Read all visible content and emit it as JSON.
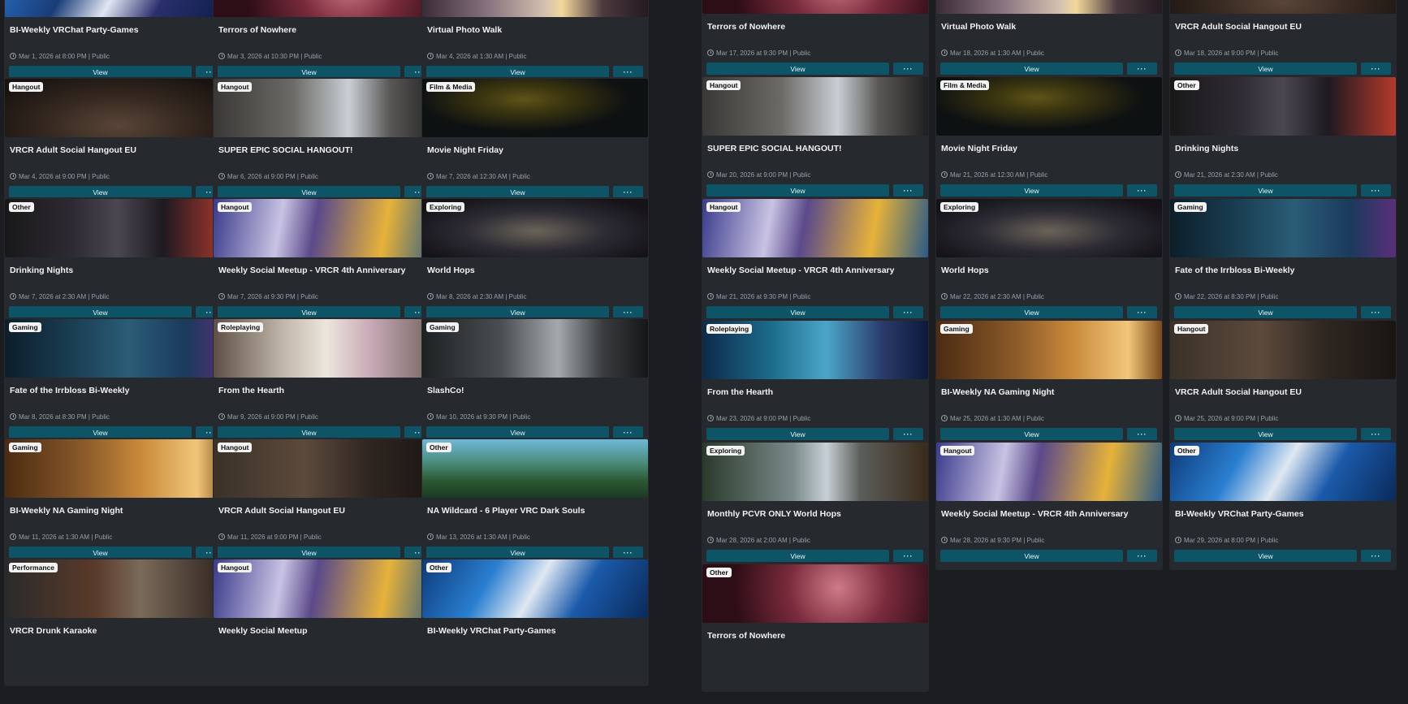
{
  "common": {
    "view_label": "View",
    "more_label": "···"
  },
  "left_cards": [
    {
      "tag": "",
      "title": "BI-Weekly VRChat Party-Games",
      "meta": "Mar 1, 2026 at 8:00 PM  |  Public",
      "thumb": "t1"
    },
    {
      "tag": "",
      "title": "Terrors of Nowhere",
      "meta": "Mar 3, 2026 at 10:30 PM  |  Public",
      "thumb": "t2"
    },
    {
      "tag": "",
      "title": "Virtual Photo Walk",
      "meta": "Mar 4, 2026 at 1:30 AM  |  Public",
      "thumb": "t3"
    },
    {
      "tag": "Hangout",
      "title": "VRCR Adult Social Hangout EU",
      "meta": "Mar 4, 2026 at 9:00 PM  |  Public",
      "thumb": "t4"
    },
    {
      "tag": "Hangout",
      "title": "SUPER EPIC SOCIAL HANGOUT!",
      "meta": "Mar 6, 2026 at 9:00 PM  |  Public",
      "thumb": "t5"
    },
    {
      "tag": "Film & Media",
      "title": "Movie Night Friday",
      "meta": "Mar 7, 2026 at 12:30 AM  |  Public",
      "thumb": "t6"
    },
    {
      "tag": "Other",
      "title": "Drinking Nights",
      "meta": "Mar 7, 2026 at 2:30 AM  |  Public",
      "thumb": "t7"
    },
    {
      "tag": "Hangout",
      "title": "Weekly Social Meetup - VRCR 4th Anniversary",
      "meta": "Mar 7, 2026 at 9:30 PM  |  Public",
      "thumb": "t8"
    },
    {
      "tag": "Exploring",
      "title": "World Hops",
      "meta": "Mar 8, 2026 at 2:30 AM  |  Public",
      "thumb": "t9"
    },
    {
      "tag": "Gaming",
      "title": "Fate of the Irrbloss Bi-Weekly",
      "meta": "Mar 8, 2026 at 8:30 PM  |  Public",
      "thumb": "t10"
    },
    {
      "tag": "Roleplaying",
      "title": "From the Hearth",
      "meta": "Mar 9, 2026 at 9:00 PM  |  Public",
      "thumb": "t11"
    },
    {
      "tag": "Gaming",
      "title": "SlashCo!",
      "meta": "Mar 10, 2026 at 9:30 PM  |  Public",
      "thumb": "t12"
    },
    {
      "tag": "Gaming",
      "title": "BI-Weekly NA Gaming Night",
      "meta": "Mar 11, 2026 at 1:30 AM  |  Public",
      "thumb": "t13"
    },
    {
      "tag": "Hangout",
      "title": "VRCR Adult Social Hangout EU",
      "meta": "Mar 11, 2026 at 9:00 PM  |  Public",
      "thumb": "t14"
    },
    {
      "tag": "Other",
      "title": "NA Wildcard - 6 Player VRC Dark Souls",
      "meta": "Mar 13, 2026 at 1:30 AM  |  Public",
      "thumb": "t15"
    },
    {
      "tag": "Performance",
      "title": "VRCR Drunk Karaoke",
      "meta": "",
      "thumb": "t16"
    },
    {
      "tag": "Hangout",
      "title": "Weekly Social Meetup",
      "meta": "",
      "thumb": "t8"
    },
    {
      "tag": "Other",
      "title": "BI-Weekly VRChat Party-Games",
      "meta": "",
      "thumb": "t17"
    }
  ],
  "right_cards": [
    {
      "tag": "",
      "title": "Terrors of Nowhere",
      "meta": "Mar 17, 2026 at 9:30 PM  |  Public",
      "thumb": "t2"
    },
    {
      "tag": "",
      "title": "Virtual Photo Walk",
      "meta": "Mar 18, 2026 at 1:30 AM  |  Public",
      "thumb": "t3"
    },
    {
      "tag": "",
      "title": "VRCR Adult Social Hangout EU",
      "meta": "Mar 18, 2026 at 9:00 PM  |  Public",
      "thumb": "t4"
    },
    {
      "tag": "Hangout",
      "title": "SUPER EPIC SOCIAL HANGOUT!",
      "meta": "Mar 20, 2026 at 9:00 PM  |  Public",
      "thumb": "t5"
    },
    {
      "tag": "Film & Media",
      "title": "Movie Night Friday",
      "meta": "Mar 21, 2026 at 12:30 AM  |  Public",
      "thumb": "t6"
    },
    {
      "tag": "Other",
      "title": "Drinking Nights",
      "meta": "Mar 21, 2026 at 2:30 AM  |  Public",
      "thumb": "t7"
    },
    {
      "tag": "Hangout",
      "title": "Weekly Social Meetup - VRCR 4th Anniversary",
      "meta": "Mar 21, 2026 at 9:30 PM  |  Public",
      "thumb": "t8"
    },
    {
      "tag": "Exploring",
      "title": "World Hops",
      "meta": "Mar 22, 2026 at 2:30 AM  |  Public",
      "thumb": "t9"
    },
    {
      "tag": "Gaming",
      "title": "Fate of the Irrbloss Bi-Weekly",
      "meta": "Mar 22, 2026 at 8:30 PM  |  Public",
      "thumb": "t10"
    },
    {
      "tag": "Roleplaying",
      "title": "From the Hearth",
      "meta": "Mar 23, 2026 at 9:00 PM  |  Public",
      "thumb": "t18"
    },
    {
      "tag": "Gaming",
      "title": "BI-Weekly NA Gaming Night",
      "meta": "Mar 25, 2026 at 1:30 AM  |  Public",
      "thumb": "t13"
    },
    {
      "tag": "Hangout",
      "title": "VRCR Adult Social Hangout EU",
      "meta": "Mar 25, 2026 at 9:00 PM  |  Public",
      "thumb": "t14"
    },
    {
      "tag": "Exploring",
      "title": "Monthly PCVR ONLY World Hops",
      "meta": "Mar 28, 2026 at 2:00 AM  |  Public",
      "thumb": "t19"
    },
    {
      "tag": "Hangout",
      "title": "Weekly Social Meetup - VRCR 4th Anniversary",
      "meta": "Mar 28, 2026 at 9:30 PM  |  Public",
      "thumb": "t8"
    },
    {
      "tag": "Other",
      "title": "BI-Weekly VRChat Party-Games",
      "meta": "Mar 29, 2026 at 8:00 PM  |  Public",
      "thumb": "t17"
    },
    {
      "tag": "Other",
      "title": "Terrors of Nowhere",
      "meta": "",
      "thumb": "t2"
    }
  ]
}
